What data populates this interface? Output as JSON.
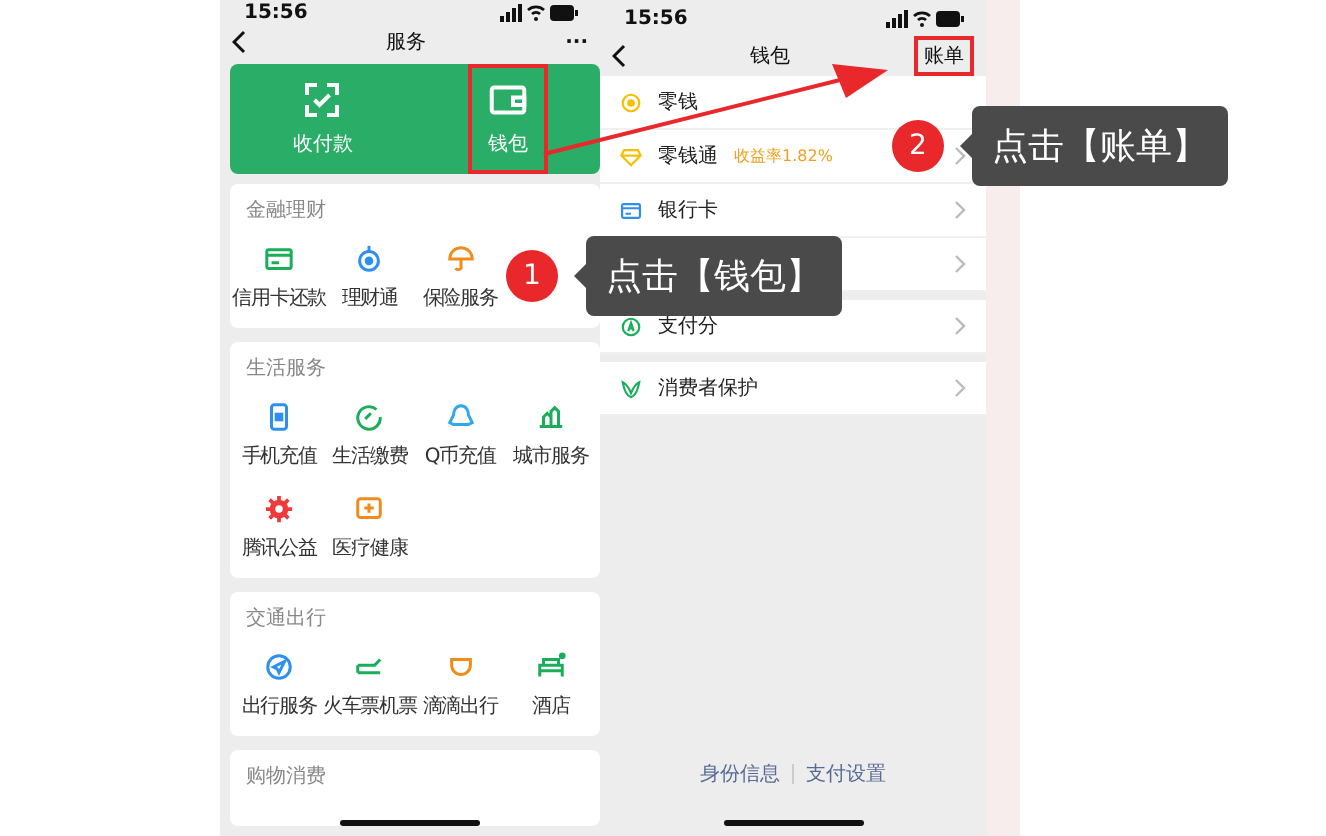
{
  "left_phone": {
    "time": "15:56",
    "title": "服务",
    "more": "···",
    "wallet_card": [
      {
        "label": "收付款",
        "kind": "scan",
        "highlighted": false
      },
      {
        "label": "钱包",
        "kind": "wallet",
        "highlighted": true
      }
    ],
    "sections": [
      {
        "title": "金融理财",
        "items": [
          {
            "label": "信用卡还款",
            "kind": "card",
            "color": "#1aad5a"
          },
          {
            "label": "理财通",
            "kind": "drop",
            "color": "#2f8ff0"
          },
          {
            "label": "保险服务",
            "kind": "umbrella",
            "color": "#f08c1a"
          }
        ]
      },
      {
        "title": "生活服务",
        "items": [
          {
            "label": "手机充值",
            "kind": "phone",
            "color": "#2f8ff0"
          },
          {
            "label": "生活缴费",
            "kind": "leaf",
            "color": "#1aad5a"
          },
          {
            "label": "Q币充值",
            "kind": "penguin",
            "color": "#2fa8f0"
          },
          {
            "label": "城市服务",
            "kind": "city",
            "color": "#1aad5a"
          },
          {
            "label": "腾讯公益",
            "kind": "flower",
            "color": "#f03a3a"
          },
          {
            "label": "医疗健康",
            "kind": "medical",
            "color": "#f08c1a"
          }
        ]
      },
      {
        "title": "交通出行",
        "items": [
          {
            "label": "出行服务",
            "kind": "compass",
            "color": "#2f8ff0"
          },
          {
            "label": "火车票机票",
            "kind": "train",
            "color": "#1aad5a"
          },
          {
            "label": "滴滴出行",
            "kind": "cup",
            "color": "#f08c1a"
          },
          {
            "label": "酒店",
            "kind": "bed",
            "color": "#1aad5a"
          }
        ]
      },
      {
        "title": "购物消费"
      }
    ]
  },
  "right_phone": {
    "time": "15:56",
    "title": "钱包",
    "bill_button": {
      "label": "账单",
      "highlighted": true
    },
    "groups": [
      [
        {
          "label": "零钱",
          "kind": "coin"
        },
        {
          "label": "零钱通",
          "kind": "diamond",
          "badge": "收益率1.82%"
        },
        {
          "label": "银行卡",
          "kind": "card"
        },
        {
          "kind": "covered"
        }
      ],
      [
        {
          "label": "支付分",
          "kind": "score"
        }
      ],
      [
        {
          "label": "消费者保护",
          "kind": "shield"
        }
      ]
    ],
    "footer_links": [
      "身份信息",
      "支付设置"
    ]
  },
  "callouts": [
    {
      "number": "1",
      "text": "点击【钱包】"
    },
    {
      "number": "2",
      "text": "点击【账单】"
    }
  ]
}
